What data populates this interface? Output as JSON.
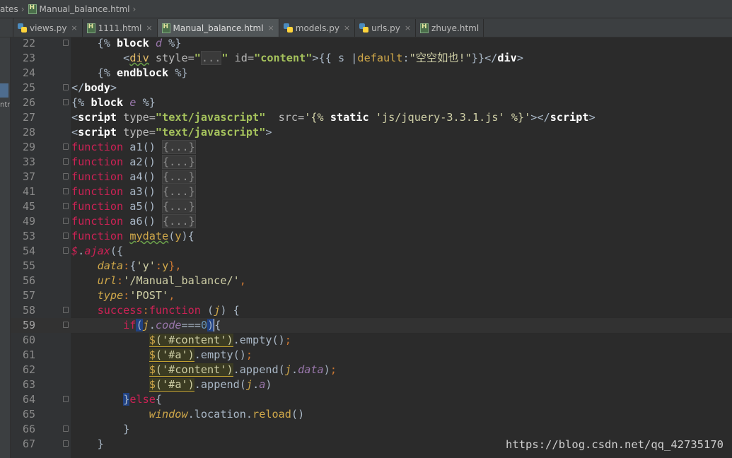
{
  "breadcrumb": {
    "parent": "ates",
    "file": "Manual_balance.html"
  },
  "tabs": [
    {
      "label": "views.py",
      "icon": "python-file-icon",
      "active": false
    },
    {
      "label": "1111.html",
      "icon": "html-file-icon",
      "active": false
    },
    {
      "label": "Manual_balance.html",
      "icon": "html-file-icon",
      "active": true
    },
    {
      "label": "models.py",
      "icon": "python-file-icon",
      "active": false
    },
    {
      "label": "urls.py",
      "icon": "python-file-icon",
      "active": false
    },
    {
      "label": "zhuye.html",
      "icon": "html-file-icon",
      "active": false
    }
  ],
  "close_glyph": "×",
  "left_strip_label": "ntm",
  "line_numbers": [
    "22",
    "23",
    "24",
    "25",
    "26",
    "27",
    "28",
    "29",
    "33",
    "37",
    "41",
    "45",
    "49",
    "53",
    "54",
    "55",
    "56",
    "57",
    "58",
    "59",
    "60",
    "61",
    "62",
    "63",
    "64",
    "65",
    "66",
    "67"
  ],
  "current_line": "59",
  "code": {
    "l22": {
      "a": "{% ",
      "b": "block",
      "c": " d ",
      "d": "%}"
    },
    "l23": {
      "lt": "<",
      "tag": "div",
      "attr": " style=",
      "q1": "\"",
      "ell": "...",
      "q2": "\"",
      "attr2": " id=",
      "idv": "\"content\"",
      "gt": ">",
      "tpl1": "{{ s |",
      "filter": "default",
      "colon": ":",
      "defv": "\"空空如也!\"",
      "tpl2": "}}",
      "close": "</",
      "ctag": "div",
      "cgt": ">"
    },
    "l24": {
      "a": "{% ",
      "b": "endblock",
      "c": " %}"
    },
    "l25": {
      "a": "</",
      "b": "body",
      "c": ">"
    },
    "l26": {
      "a": "{% ",
      "b": "block",
      "c": " e ",
      "d": "%}"
    },
    "l27": {
      "a": "<",
      "b": "script",
      "c": " type=",
      "d": "\"text/javascript\"",
      "e": "  src=",
      "f": "'{% ",
      "g": "static",
      "h": " 'js/jquery-3.3.1.js' %}'",
      "i": "></",
      "j": "script",
      "k": ">"
    },
    "l28": {
      "a": "<",
      "b": "script",
      "c": " type=",
      "d": "\"text/javascript\"",
      "e": ">"
    },
    "funcs": [
      {
        "kw": "function",
        "name": " a1() ",
        "body": "{...}"
      },
      {
        "kw": "function",
        "name": " a2() ",
        "body": "{...}"
      },
      {
        "kw": "function",
        "name": " a4() ",
        "body": "{...}"
      },
      {
        "kw": "function",
        "name": " a3() ",
        "body": "{...}"
      },
      {
        "kw": "function",
        "name": " a5() ",
        "body": "{...}"
      },
      {
        "kw": "function",
        "name": " a6() ",
        "body": "{...}"
      }
    ],
    "l53": {
      "kw": "function",
      "sp": " ",
      "name": "mydate",
      "p1": "(",
      "param": "y",
      "p2": "){"
    },
    "l54": {
      "a": "$",
      "b": ".",
      "c": "ajax",
      "d": "({"
    },
    "l55": {
      "key": "data",
      "colon": ":",
      "v1": "{",
      "s": "'y'",
      "c2": ":",
      "p": "y",
      "v2": "},",
      "comma": ""
    },
    "l56": {
      "key": "url",
      "colon": ":",
      "s": "'/Manual_balance/'",
      "comma": ","
    },
    "l57": {
      "key": "type",
      "colon": ":",
      "s": "'POST'",
      "comma": ","
    },
    "l58": {
      "key": "success",
      "colon": ":",
      "kw": "function",
      "sp": " (",
      "p": "j",
      "rest": ") {"
    },
    "l59": {
      "kw": "if",
      "open": "(",
      "j": "j",
      "dot": ".",
      "prop": "code",
      "op": "===",
      "num": "0",
      "close": ")",
      "brace": "{"
    },
    "l60": {
      "fn": "$",
      "arg": "('#content')",
      "rest": ".empty()",
      "semi": ";"
    },
    "l61": {
      "fn": "$",
      "arg": "('#a')",
      "rest": ".empty()",
      "semi": ";"
    },
    "l62": {
      "fn": "$",
      "arg": "('#content')",
      "rest": ".append(",
      "j": "j",
      "dot": ".",
      "prop": "data",
      "close": ")",
      "semi": ";"
    },
    "l63": {
      "fn": "$",
      "arg": "('#a')",
      "rest": ".append(",
      "j": "j",
      "dot": ".",
      "prop": "a",
      "close": ")"
    },
    "l64": {
      "brace": "}",
      "kw": "else",
      "open": "{"
    },
    "l65": {
      "obj": "window",
      "rest": ".location.",
      "fn": "reload",
      "call": "()"
    },
    "l66": {
      "brace": "}"
    },
    "l67": {
      "brace": "}"
    }
  },
  "watermark": "https://blog.csdn.net/qq_42735170"
}
